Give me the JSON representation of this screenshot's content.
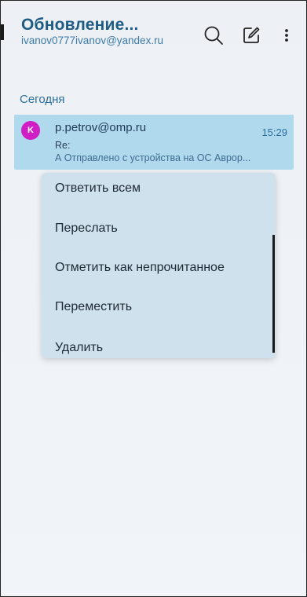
{
  "header": {
    "title": "Обновление...",
    "account": "ivanov0777ivanov@yandex.ru",
    "icons": [
      "search-icon",
      "compose-icon",
      "more-vertical-icon"
    ]
  },
  "section": {
    "label": "Сегодня"
  },
  "message": {
    "avatar_letter": "K",
    "sender": "p.petrov@omp.ru",
    "time": "15:29",
    "subject": "Re:",
    "preview": "А Отправлено с устройства на ОС Аврор..."
  },
  "context_menu": {
    "items": [
      {
        "label": "Ответить всем"
      },
      {
        "label": "Переслать"
      },
      {
        "label": "Отметить как непрочитанное"
      },
      {
        "label": "Переместить"
      },
      {
        "label": "Удалить"
      }
    ]
  },
  "colors": {
    "accent": "#1f5c83",
    "selected_row": "#b0d9ee",
    "avatar": "#d11fc6",
    "menu_bg": "#cfe1ec"
  }
}
